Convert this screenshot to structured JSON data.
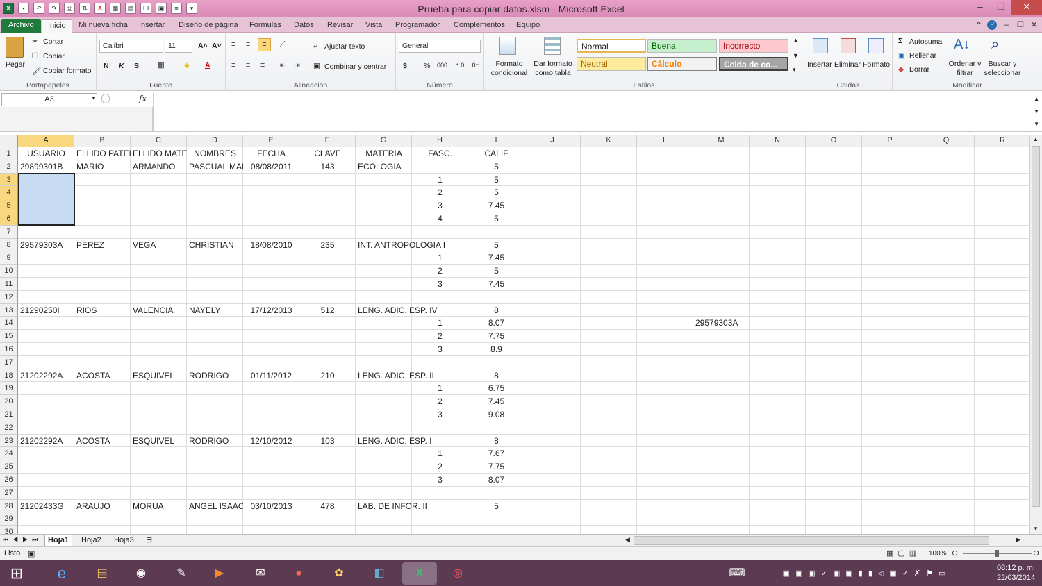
{
  "window": {
    "title": "Prueba para copiar datos.xlsm - Microsoft Excel"
  },
  "tabs": [
    "Archivo",
    "Inicio",
    "Mi nueva ficha",
    "Insertar",
    "Diseño de página",
    "Fórmulas",
    "Datos",
    "Revisar",
    "Vista",
    "Programador",
    "Complementos",
    "Equipo"
  ],
  "ribbon": {
    "clipboard": {
      "paste": "Pegar",
      "cut": "Cortar",
      "copy": "Copiar",
      "format_painter": "Copiar formato",
      "label": "Portapapeles"
    },
    "font": {
      "name": "Calibri",
      "size": "11",
      "label": "Fuente"
    },
    "alignment": {
      "wrap": "Ajustar texto",
      "merge": "Combinar y centrar",
      "label": "Alineación"
    },
    "number": {
      "format": "General",
      "label": "Número"
    },
    "styles": {
      "cond": "Formato condicional",
      "table": "Dar formato como tabla",
      "label": "Estilos",
      "cells": [
        {
          "text": "Normal",
          "bg": "#ffffff"
        },
        {
          "text": "Buena",
          "bg": "#c6efce"
        },
        {
          "text": "Incorrecto",
          "bg": "#ffc7ce"
        },
        {
          "text": "Neutral",
          "bg": "#ffeb9c"
        },
        {
          "text": "Cálculo",
          "bg": "#f2f2f2"
        },
        {
          "text": "Celda de co...",
          "bg": "#a5a5a5"
        }
      ]
    },
    "cells": {
      "insert": "Insertar",
      "delete": "Eliminar",
      "format": "Formato",
      "label": "Celdas"
    },
    "editing": {
      "autosum": "Autosuma",
      "fill": "Rellenar",
      "clear": "Borrar",
      "sort": "Ordenar y filtrar",
      "find": "Buscar y seleccionar",
      "label": "Modificar"
    }
  },
  "formula_bar": {
    "name_box": "A3",
    "fx": "fx",
    "content": ""
  },
  "columns": [
    "A",
    "B",
    "C",
    "D",
    "E",
    "F",
    "G",
    "H",
    "I",
    "J",
    "K",
    "L",
    "M",
    "N",
    "O",
    "P",
    "Q",
    "R"
  ],
  "selected_column": "A",
  "selected_rows": [
    "3",
    "4",
    "5",
    "6"
  ],
  "rows": [
    {
      "n": "1",
      "A": "USUARIO",
      "B": "ELLIDO PATER",
      "C": "ELLIDO MATER",
      "D": "NOMBRES",
      "E": "FECHA",
      "F": "CLAVE",
      "G": "MATERIA",
      "H": "FASC.",
      "I": "CALIF"
    },
    {
      "n": "2",
      "A": "29899301B",
      "B": "MARIO",
      "C": "ARMANDO",
      "D": "PASCUAL MAI",
      "E": "08/08/2011",
      "F": "143",
      "G": "ECOLOGIA",
      "I": "5"
    },
    {
      "n": "3",
      "H": "1",
      "I": "5"
    },
    {
      "n": "4",
      "H": "2",
      "I": "5"
    },
    {
      "n": "5",
      "H": "3",
      "I": "7.45"
    },
    {
      "n": "6",
      "H": "4",
      "I": "5"
    },
    {
      "n": "7"
    },
    {
      "n": "8",
      "A": "29579303A",
      "B": "PEREZ",
      "C": "VEGA",
      "D": "CHRISTIAN",
      "E": "18/08/2010",
      "F": "235",
      "G": "INT. ANTROPOLOGIA I",
      "I": "5"
    },
    {
      "n": "9",
      "H": "1",
      "I": "7.45"
    },
    {
      "n": "10",
      "H": "2",
      "I": "5"
    },
    {
      "n": "11",
      "H": "3",
      "I": "7.45"
    },
    {
      "n": "12"
    },
    {
      "n": "13",
      "A": "21290250I",
      "B": "RIOS",
      "C": "VALENCIA",
      "D": "NAYELY",
      "E": "17/12/2013",
      "F": "512",
      "G": "LENG. ADIC. ESP. IV",
      "I": "8"
    },
    {
      "n": "14",
      "H": "1",
      "I": "8.07",
      "M": "29579303A"
    },
    {
      "n": "15",
      "H": "2",
      "I": "7.75"
    },
    {
      "n": "16",
      "H": "3",
      "I": "8.9"
    },
    {
      "n": "17"
    },
    {
      "n": "18",
      "A": "21202292A",
      "B": "ACOSTA",
      "C": "ESQUIVEL",
      "D": "RODRIGO",
      "E": "01/11/2012",
      "F": "210",
      "G": "LENG. ADIC. ESP. II",
      "I": "8"
    },
    {
      "n": "19",
      "H": "1",
      "I": "6.75"
    },
    {
      "n": "20",
      "H": "2",
      "I": "7.45"
    },
    {
      "n": "21",
      "H": "3",
      "I": "9.08"
    },
    {
      "n": "22"
    },
    {
      "n": "23",
      "A": "21202292A",
      "B": "ACOSTA",
      "C": "ESQUIVEL",
      "D": "RODRIGO",
      "E": "12/10/2012",
      "F": "103",
      "G": "LENG. ADIC. ESP. I",
      "I": "8"
    },
    {
      "n": "24",
      "H": "1",
      "I": "7.67"
    },
    {
      "n": "25",
      "H": "2",
      "I": "7.75"
    },
    {
      "n": "26",
      "H": "3",
      "I": "8.07"
    },
    {
      "n": "27"
    },
    {
      "n": "28",
      "A": "21202433G",
      "B": "ARAUJO",
      "C": "MORUA",
      "D": "ANGEL ISAAC",
      "E": "03/10/2013",
      "F": "478",
      "G": "LAB. DE INFOR. II",
      "I": "5"
    },
    {
      "n": "29"
    },
    {
      "n": "30"
    }
  ],
  "sheets": [
    "Hoja1",
    "Hoja2",
    "Hoja3"
  ],
  "active_sheet": "Hoja1",
  "status": {
    "ready": "Listo",
    "zoom": "100%"
  },
  "taskbar": {
    "time": "08:12 p. m.",
    "date": "22/03/2014"
  }
}
